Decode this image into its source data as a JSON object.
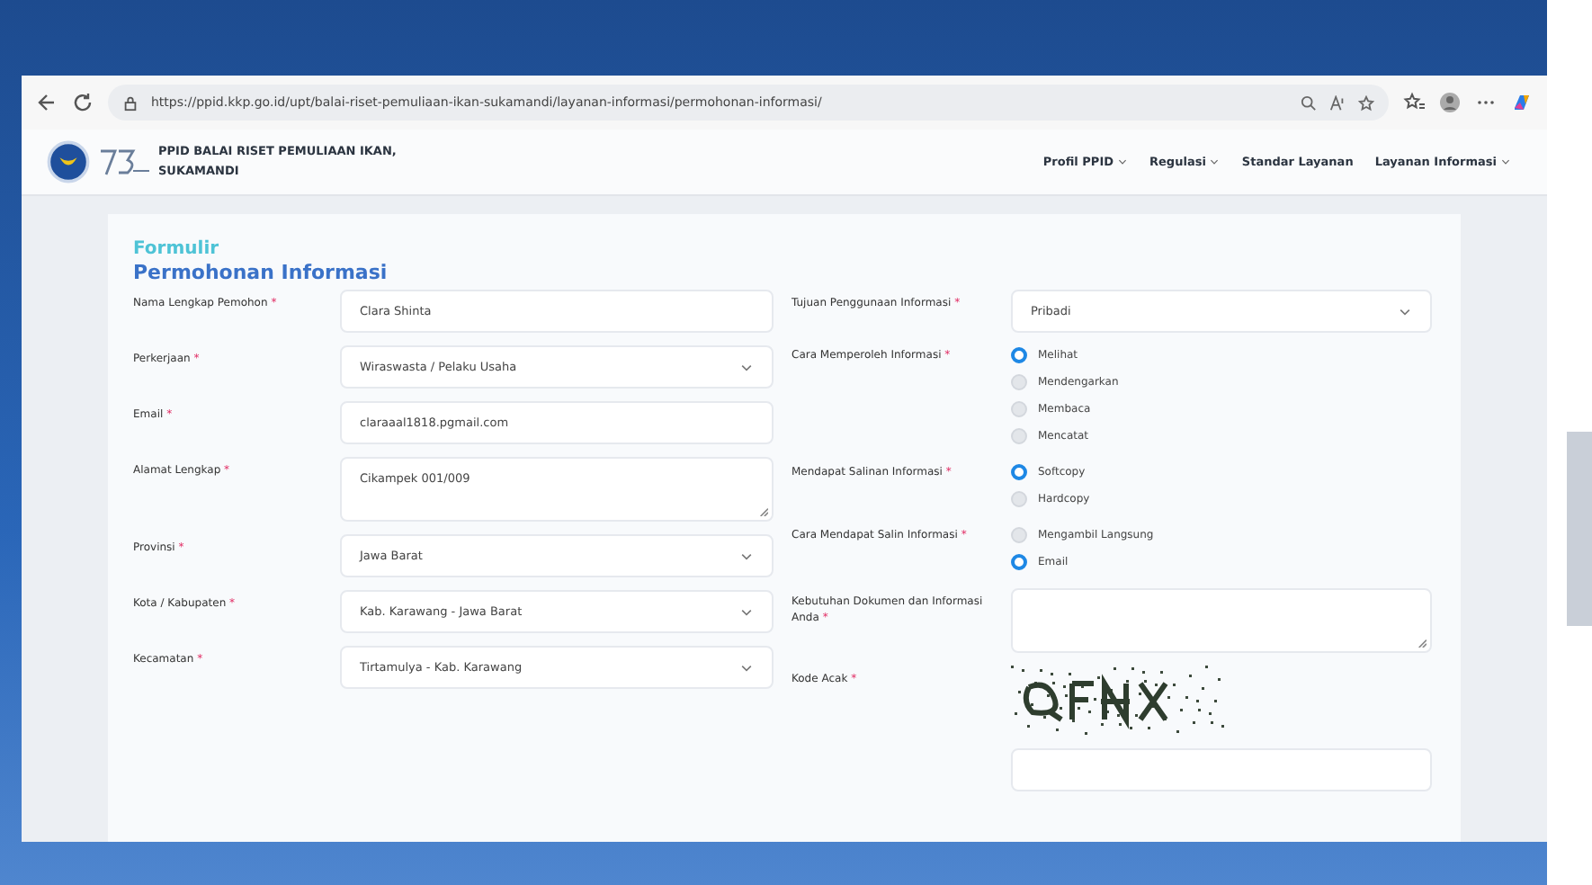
{
  "browser": {
    "url": "https://ppid.kkp.go.id/upt/balai-riset-pemuliaan-ikan-sukamandi/layanan-informasi/permohonan-informasi/"
  },
  "site": {
    "title_lines": [
      "PPID BALAI RISET PEMULIAAN IKAN,",
      "SUKAMANDI"
    ],
    "nav": [
      {
        "label": "Profil PPID",
        "dropdown": true
      },
      {
        "label": "Regulasi",
        "dropdown": true
      },
      {
        "label": "Standar Layanan",
        "dropdown": false
      },
      {
        "label": "Layanan Informasi",
        "dropdown": true
      }
    ]
  },
  "form": {
    "title": "Formulir",
    "subtitle": "Permohonan Informasi",
    "left_fields": [
      {
        "label": "Nama Lengkap Pemohon",
        "mark": "*",
        "kind": "text",
        "value": "Clara Shinta"
      },
      {
        "label": "Perkerjaan",
        "mark": "*",
        "kind": "select",
        "value": "Wiraswasta / Pelaku Usaha"
      },
      {
        "label": "Email",
        "mark": "*",
        "kind": "text",
        "value": "claraaal1818.pgmail.com"
      },
      {
        "label": "Alamat Lengkap",
        "mark": "*",
        "kind": "textarea",
        "value": "Cikampek 001/009"
      },
      {
        "label": "Provinsi",
        "mark": "*",
        "kind": "select",
        "value": "Jawa Barat"
      },
      {
        "label": "Kota / Kabupaten",
        "mark": "*",
        "kind": "select",
        "value": "Kab. Karawang - Jawa Barat"
      },
      {
        "label": "Kecamatan",
        "mark": "*",
        "kind": "select",
        "value": "Tirtamulya - Kab. Karawang"
      }
    ],
    "right_fields": [
      {
        "label": "Tujuan Penggunaan Informasi",
        "mark": "*",
        "kind": "select",
        "value": "Pribadi"
      },
      {
        "label": "Cara Memperoleh Informasi",
        "mark": "*",
        "kind": "radio",
        "options": [
          {
            "label": "Melihat",
            "selected": true
          },
          {
            "label": "Mendengarkan",
            "selected": false
          },
          {
            "label": "Membaca",
            "selected": false
          },
          {
            "label": "Mencatat",
            "selected": false
          }
        ]
      },
      {
        "label": "Mendapat Salinan Informasi",
        "mark": "*",
        "kind": "radio",
        "options": [
          {
            "label": "Softcopy",
            "selected": true
          },
          {
            "label": "Hardcopy",
            "selected": false
          }
        ]
      },
      {
        "label": "Cara Mendapat Salin Informasi",
        "mark": "*",
        "kind": "radio",
        "options": [
          {
            "label": "Mengambil Langsung",
            "selected": false
          },
          {
            "label": "Email",
            "selected": true
          }
        ]
      },
      {
        "label": "Kebutuhan Dokumen dan Informasi Anda",
        "mark": "*",
        "kind": "textarea"
      },
      {
        "label": "Kode Acak",
        "mark": "*",
        "kind": "captcha"
      }
    ]
  }
}
